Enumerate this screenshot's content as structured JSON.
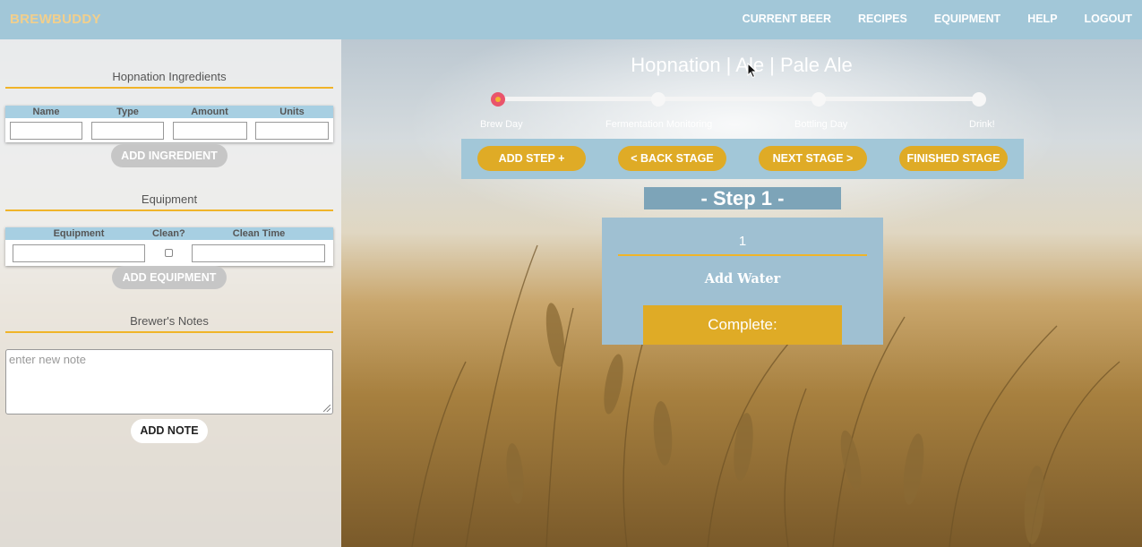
{
  "app": {
    "logo": "BREWBUDDY"
  },
  "nav": {
    "items": [
      {
        "label": "CURRENT BEER"
      },
      {
        "label": "RECIPES"
      },
      {
        "label": "EQUIPMENT"
      },
      {
        "label": "HELP"
      },
      {
        "label": "LOGOUT"
      }
    ]
  },
  "ingredients": {
    "title": "Hopnation Ingredients",
    "columns": [
      "Name",
      "Type",
      "Amount",
      "Units"
    ],
    "add_button": "ADD INGREDIENT"
  },
  "equipment": {
    "title": "Equipment",
    "columns": [
      "Equipment",
      "Clean?",
      "Clean Time"
    ],
    "add_button": "ADD EQUIPMENT"
  },
  "notes": {
    "title": "Brewer's Notes",
    "placeholder": "enter new note",
    "add_button": "ADD NOTE"
  },
  "beer": {
    "title": "Hopnation | Ale | Pale Ale"
  },
  "stages": [
    {
      "label": "Brew Day",
      "active": true
    },
    {
      "label": "Fermentation Monitoring",
      "active": false
    },
    {
      "label": "Bottling Day",
      "active": false
    },
    {
      "label": "Drink!",
      "active": false
    }
  ],
  "stage_controls": {
    "add_step": "ADD STEP +",
    "back_stage": "< BACK STAGE",
    "next_stage": "NEXT STAGE >",
    "finished_stage": "FINISHED STAGE"
  },
  "step": {
    "heading": "- Step 1 -",
    "number": "1",
    "name": "Add Water",
    "complete_label": "Complete:"
  },
  "colors": {
    "nav_bg": "#a2c7d8",
    "accent_gold": "#dfab26",
    "underline_gold": "#f0b429",
    "active_node": "#e9546b",
    "logo": "#f2cf8c"
  }
}
